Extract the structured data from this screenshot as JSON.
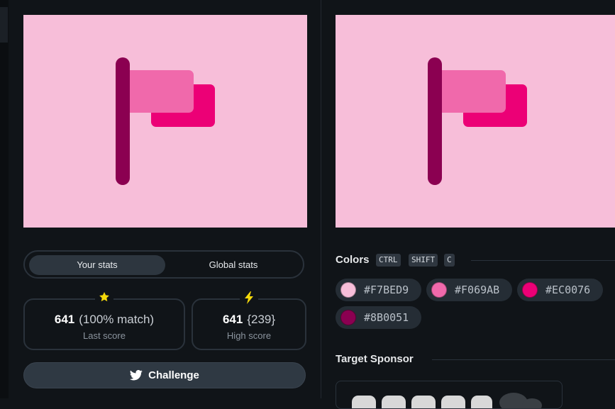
{
  "canvas": {
    "background": "#F7BED9",
    "pole_color": "#8B0051",
    "flag_front_color": "#F069AB",
    "flag_back_color": "#EC0076"
  },
  "stats": {
    "tabs": [
      "Your stats",
      "Global stats"
    ],
    "active_tab": "Your stats",
    "last": {
      "icon": "star-icon",
      "icon_color": "#F5D90A",
      "score": "641",
      "detail": "(100% match)",
      "caption": "Last score"
    },
    "high": {
      "icon": "lightning-icon",
      "icon_color": "#F5D90A",
      "score": "641",
      "detail": "{239}",
      "caption": "High score"
    }
  },
  "challenge": {
    "label": "Challenge",
    "icon": "twitter-icon"
  },
  "colors": {
    "heading": "Colors",
    "shortcut": [
      "CTRL",
      "SHIFT",
      "C"
    ],
    "swatches": [
      {
        "hex": "#F7BED9"
      },
      {
        "hex": "#F069AB"
      },
      {
        "hex": "#EC0076"
      },
      {
        "hex": "#8B0051"
      }
    ]
  },
  "sponsor": {
    "heading": "Target Sponsor"
  }
}
